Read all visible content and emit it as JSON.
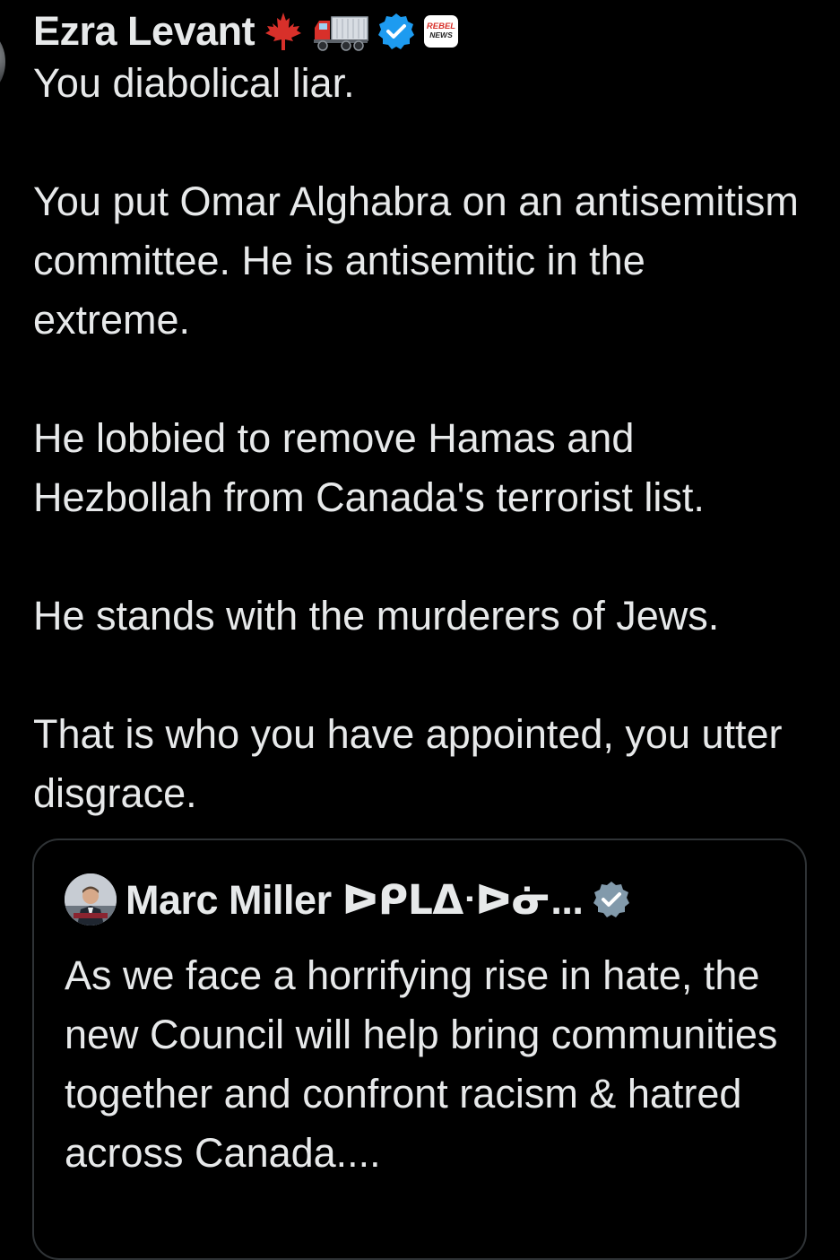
{
  "tweet": {
    "author_name": "Ezra Levant",
    "badges": [
      "maple-leaf-emoji",
      "truck-emoji",
      "verified-badge",
      "rebel-news-affiliate-badge"
    ],
    "affiliate_badge_text": [
      "REBEL",
      "NEWS"
    ],
    "paragraphs": [
      "You diabolical liar.",
      "You put Omar Alghabra on an antisemitism committee. He is antisemitic in the extreme.",
      "He lobbied to remove Hamas and Hezbollah from Canada's terrorist list.",
      "He stands with the murderers of Jews.",
      "That is who you have appointed, you utter disgrace."
    ]
  },
  "quoted_tweet": {
    "author_name": "Marc Miller ᐅᑭᒪᐃᐧᐅᓃ...",
    "badge": "verified-badge-gray",
    "text": "As we face a horrifying rise in hate, the new Council will help bring communities together and confront racism & hatred across Canada...."
  },
  "colors": {
    "background": "#000000",
    "text": "#e7e9ea",
    "verified_blue": "#1d9bf0",
    "verified_gray": "#829aab",
    "border": "#2f3336"
  }
}
